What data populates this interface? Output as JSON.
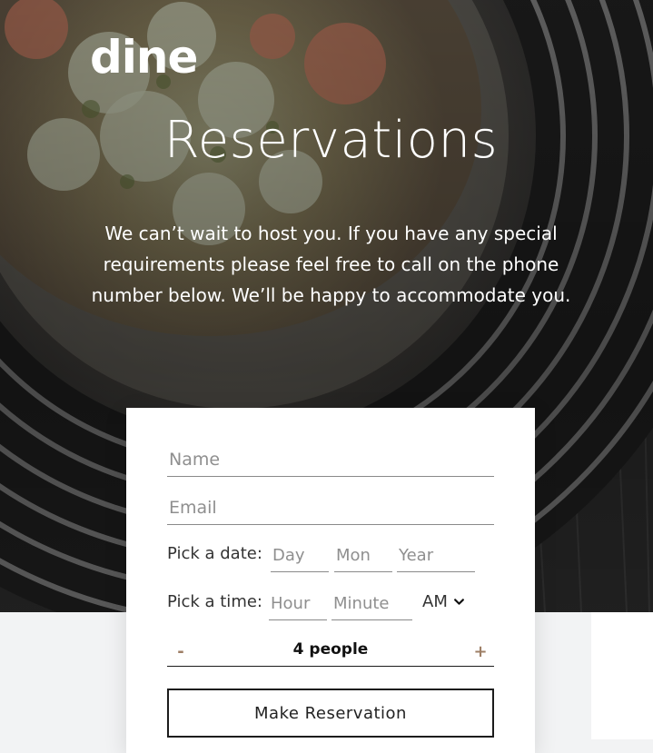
{
  "brand": {
    "logo": "dine"
  },
  "hero": {
    "title": "Reservations",
    "intro": "We can’t wait to host you. If you have any special requirements please feel free to call on the phone number below. We’ll be happy to accommodate you."
  },
  "form": {
    "name_placeholder": "Name",
    "email_placeholder": "Email",
    "date": {
      "label": "Pick a date:",
      "day_placeholder": "Day",
      "month_placeholder": "Mon",
      "year_placeholder": "Year"
    },
    "time": {
      "label": "Pick a time:",
      "hour_placeholder": "Hour",
      "minute_placeholder": "Minute",
      "period": "AM",
      "period_icon": "chevron-down-icon"
    },
    "people": {
      "minus_label": "-",
      "value_label": "4 people",
      "plus_label": "+"
    },
    "submit_label": "Make Reservation"
  },
  "colors": {
    "accent": "#9e7f66",
    "dark": "#1c1c1c",
    "text": "#333333"
  }
}
